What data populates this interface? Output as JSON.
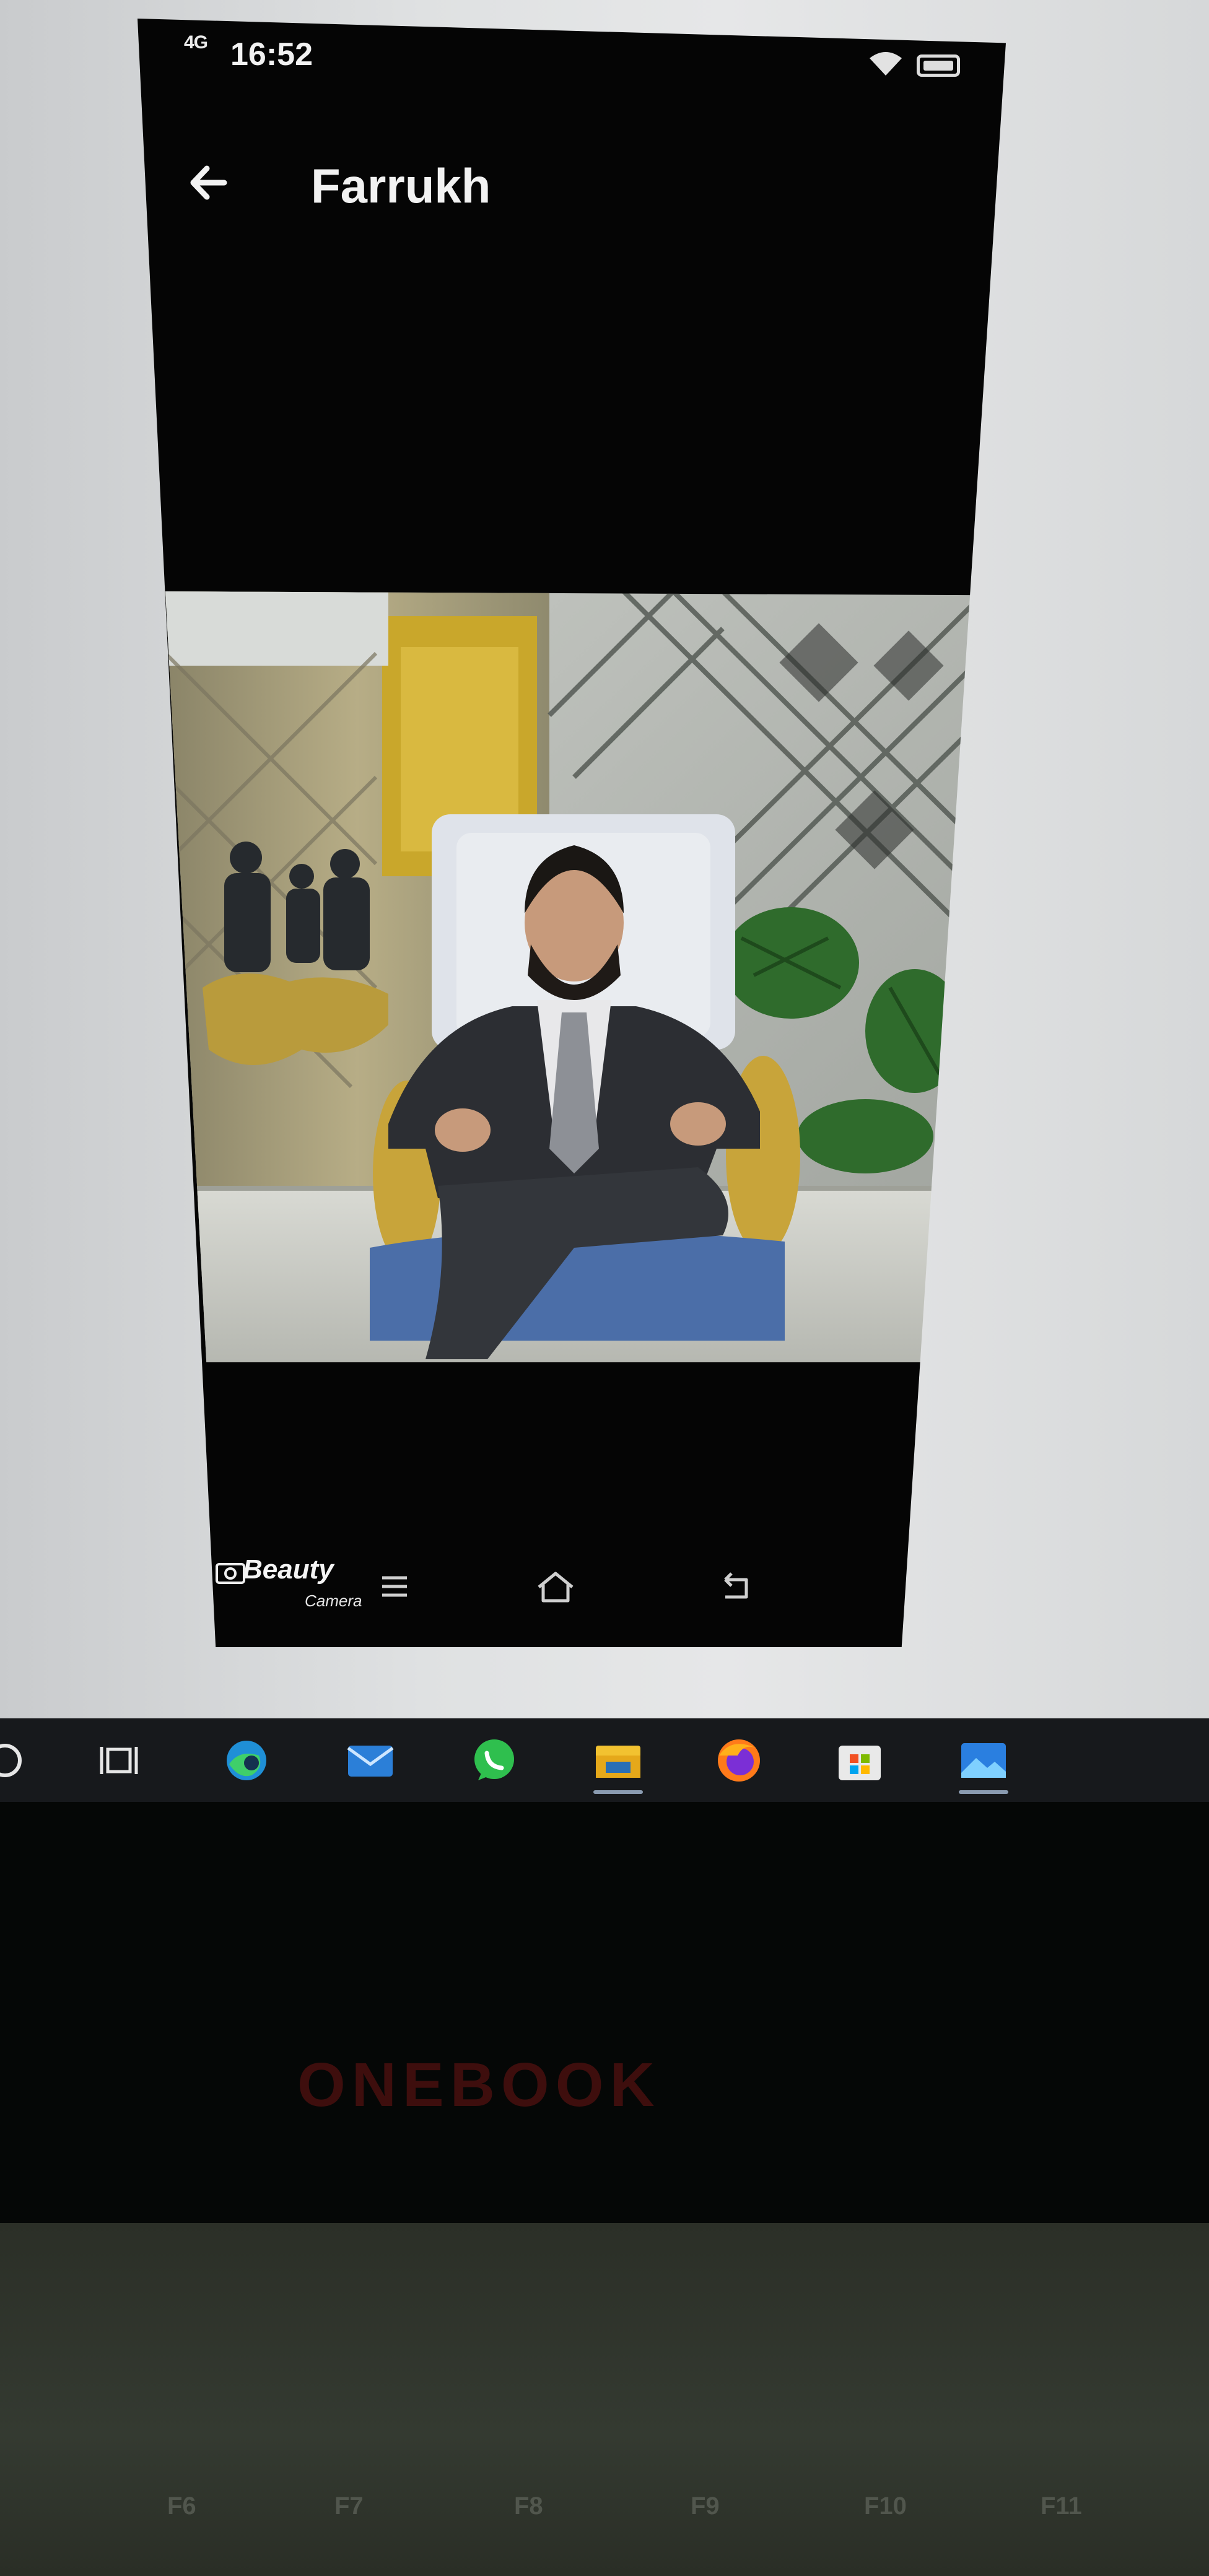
{
  "phone": {
    "status_bar": {
      "network": "4G",
      "time": "16:52"
    },
    "app_bar": {
      "title": "Farrukh"
    },
    "watermark": {
      "brand": "Beauty",
      "subtitle": "Camera"
    }
  },
  "taskbar": {
    "apps": [
      "search",
      "task-view",
      "edge",
      "mail",
      "whatsapp",
      "file-explorer",
      "firefox",
      "microsoft-store",
      "photos"
    ]
  },
  "laptop": {
    "brand": "ONEBOOK"
  },
  "keyboard": {
    "keys": [
      "F6",
      "F7",
      "F8",
      "F9",
      "F10",
      "F11"
    ]
  }
}
